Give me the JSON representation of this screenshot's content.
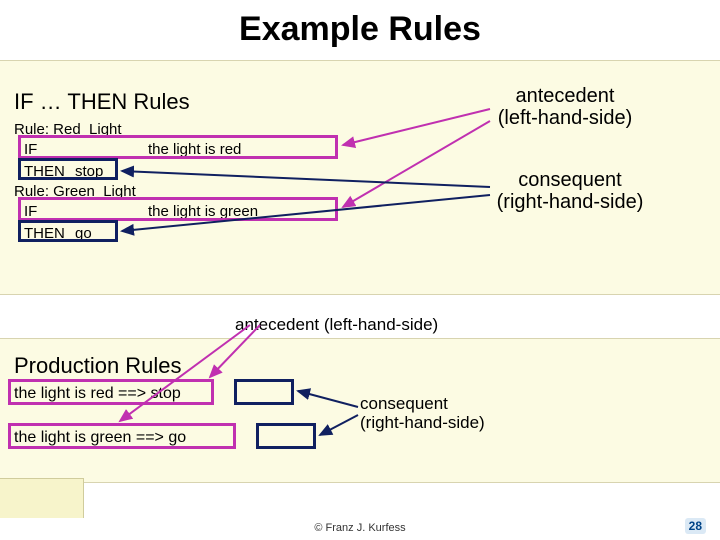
{
  "title": "Example Rules",
  "panel1": {
    "heading": "IF … THEN Rules",
    "rule1_name": "Rule: Red_Light",
    "rule1_if_kw": "IF",
    "rule1_if_cond": "the light is red",
    "rule1_then_kw": "THEN",
    "rule1_then_act": "stop",
    "rule2_name": "Rule: Green_Light",
    "rule2_if_kw": "IF",
    "rule2_if_cond": "the light is green",
    "rule2_then_kw": "THEN",
    "rule2_then_act": "go",
    "annot_antecedent_l1": "antecedent",
    "annot_antecedent_l2": "(left-hand-side)",
    "annot_consequent_l1": "consequent",
    "annot_consequent_l2": "(right-hand-side)"
  },
  "panel2": {
    "heading": "Production Rules",
    "rule1": "the light is red ==> stop",
    "rule2": "the light is green ==> go",
    "annot_antecedent": "antecedent (left-hand-side)",
    "annot_consequent_l1": "consequent",
    "annot_consequent_l2": "(right-hand-side)"
  },
  "footer": {
    "copyright": "© Franz J. Kurfess",
    "slide_number": "28"
  }
}
